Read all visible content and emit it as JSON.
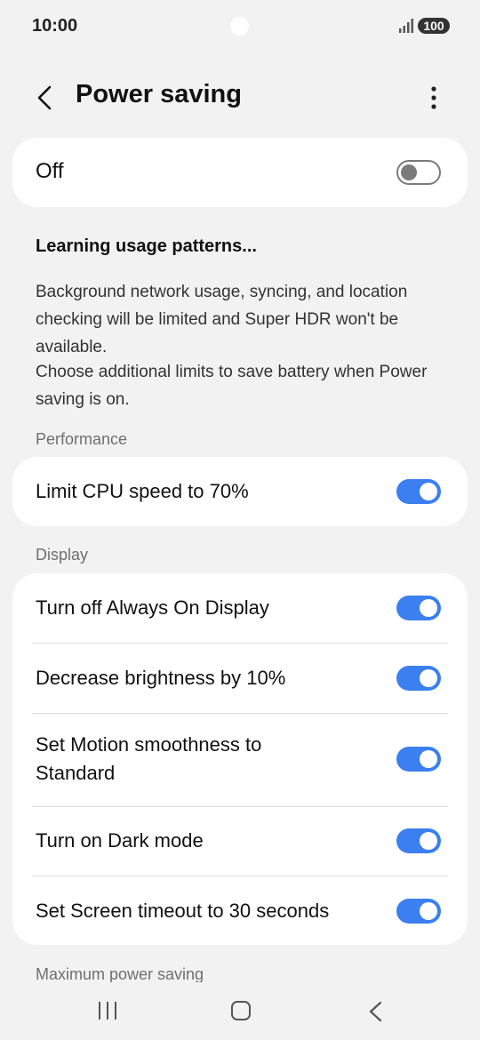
{
  "status_bar": {
    "time": "10:00",
    "battery": "100"
  },
  "header": {
    "title": "Power saving",
    "back_icon": "back-arrow-icon",
    "more_icon": "more-vertical-icon"
  },
  "master": {
    "label": "Off",
    "enabled": false
  },
  "info": {
    "learning": "Learning usage patterns...",
    "description": "Background network usage, syncing, and location checking will be limited and Super HDR won't be available.",
    "additional": "Choose additional limits to save battery when Power saving is on."
  },
  "sections": {
    "performance": {
      "title": "Performance",
      "items": [
        {
          "label": "Limit CPU speed to 70%",
          "enabled": true
        }
      ]
    },
    "display": {
      "title": "Display",
      "items": [
        {
          "label": "Turn off Always On Display",
          "enabled": true
        },
        {
          "label": "Decrease brightness by 10%",
          "enabled": true
        },
        {
          "label": "Set Motion smoothness to Standard",
          "enabled": true
        },
        {
          "label": "Turn on Dark mode",
          "enabled": true
        },
        {
          "label": "Set Screen timeout to 30 seconds",
          "enabled": true
        }
      ]
    },
    "maximum": {
      "title": "Maximum power saving"
    }
  },
  "colors": {
    "toggle_on": "#3b7ff0",
    "toggle_off": "#7b7b7b",
    "background": "#f2f2f2"
  }
}
